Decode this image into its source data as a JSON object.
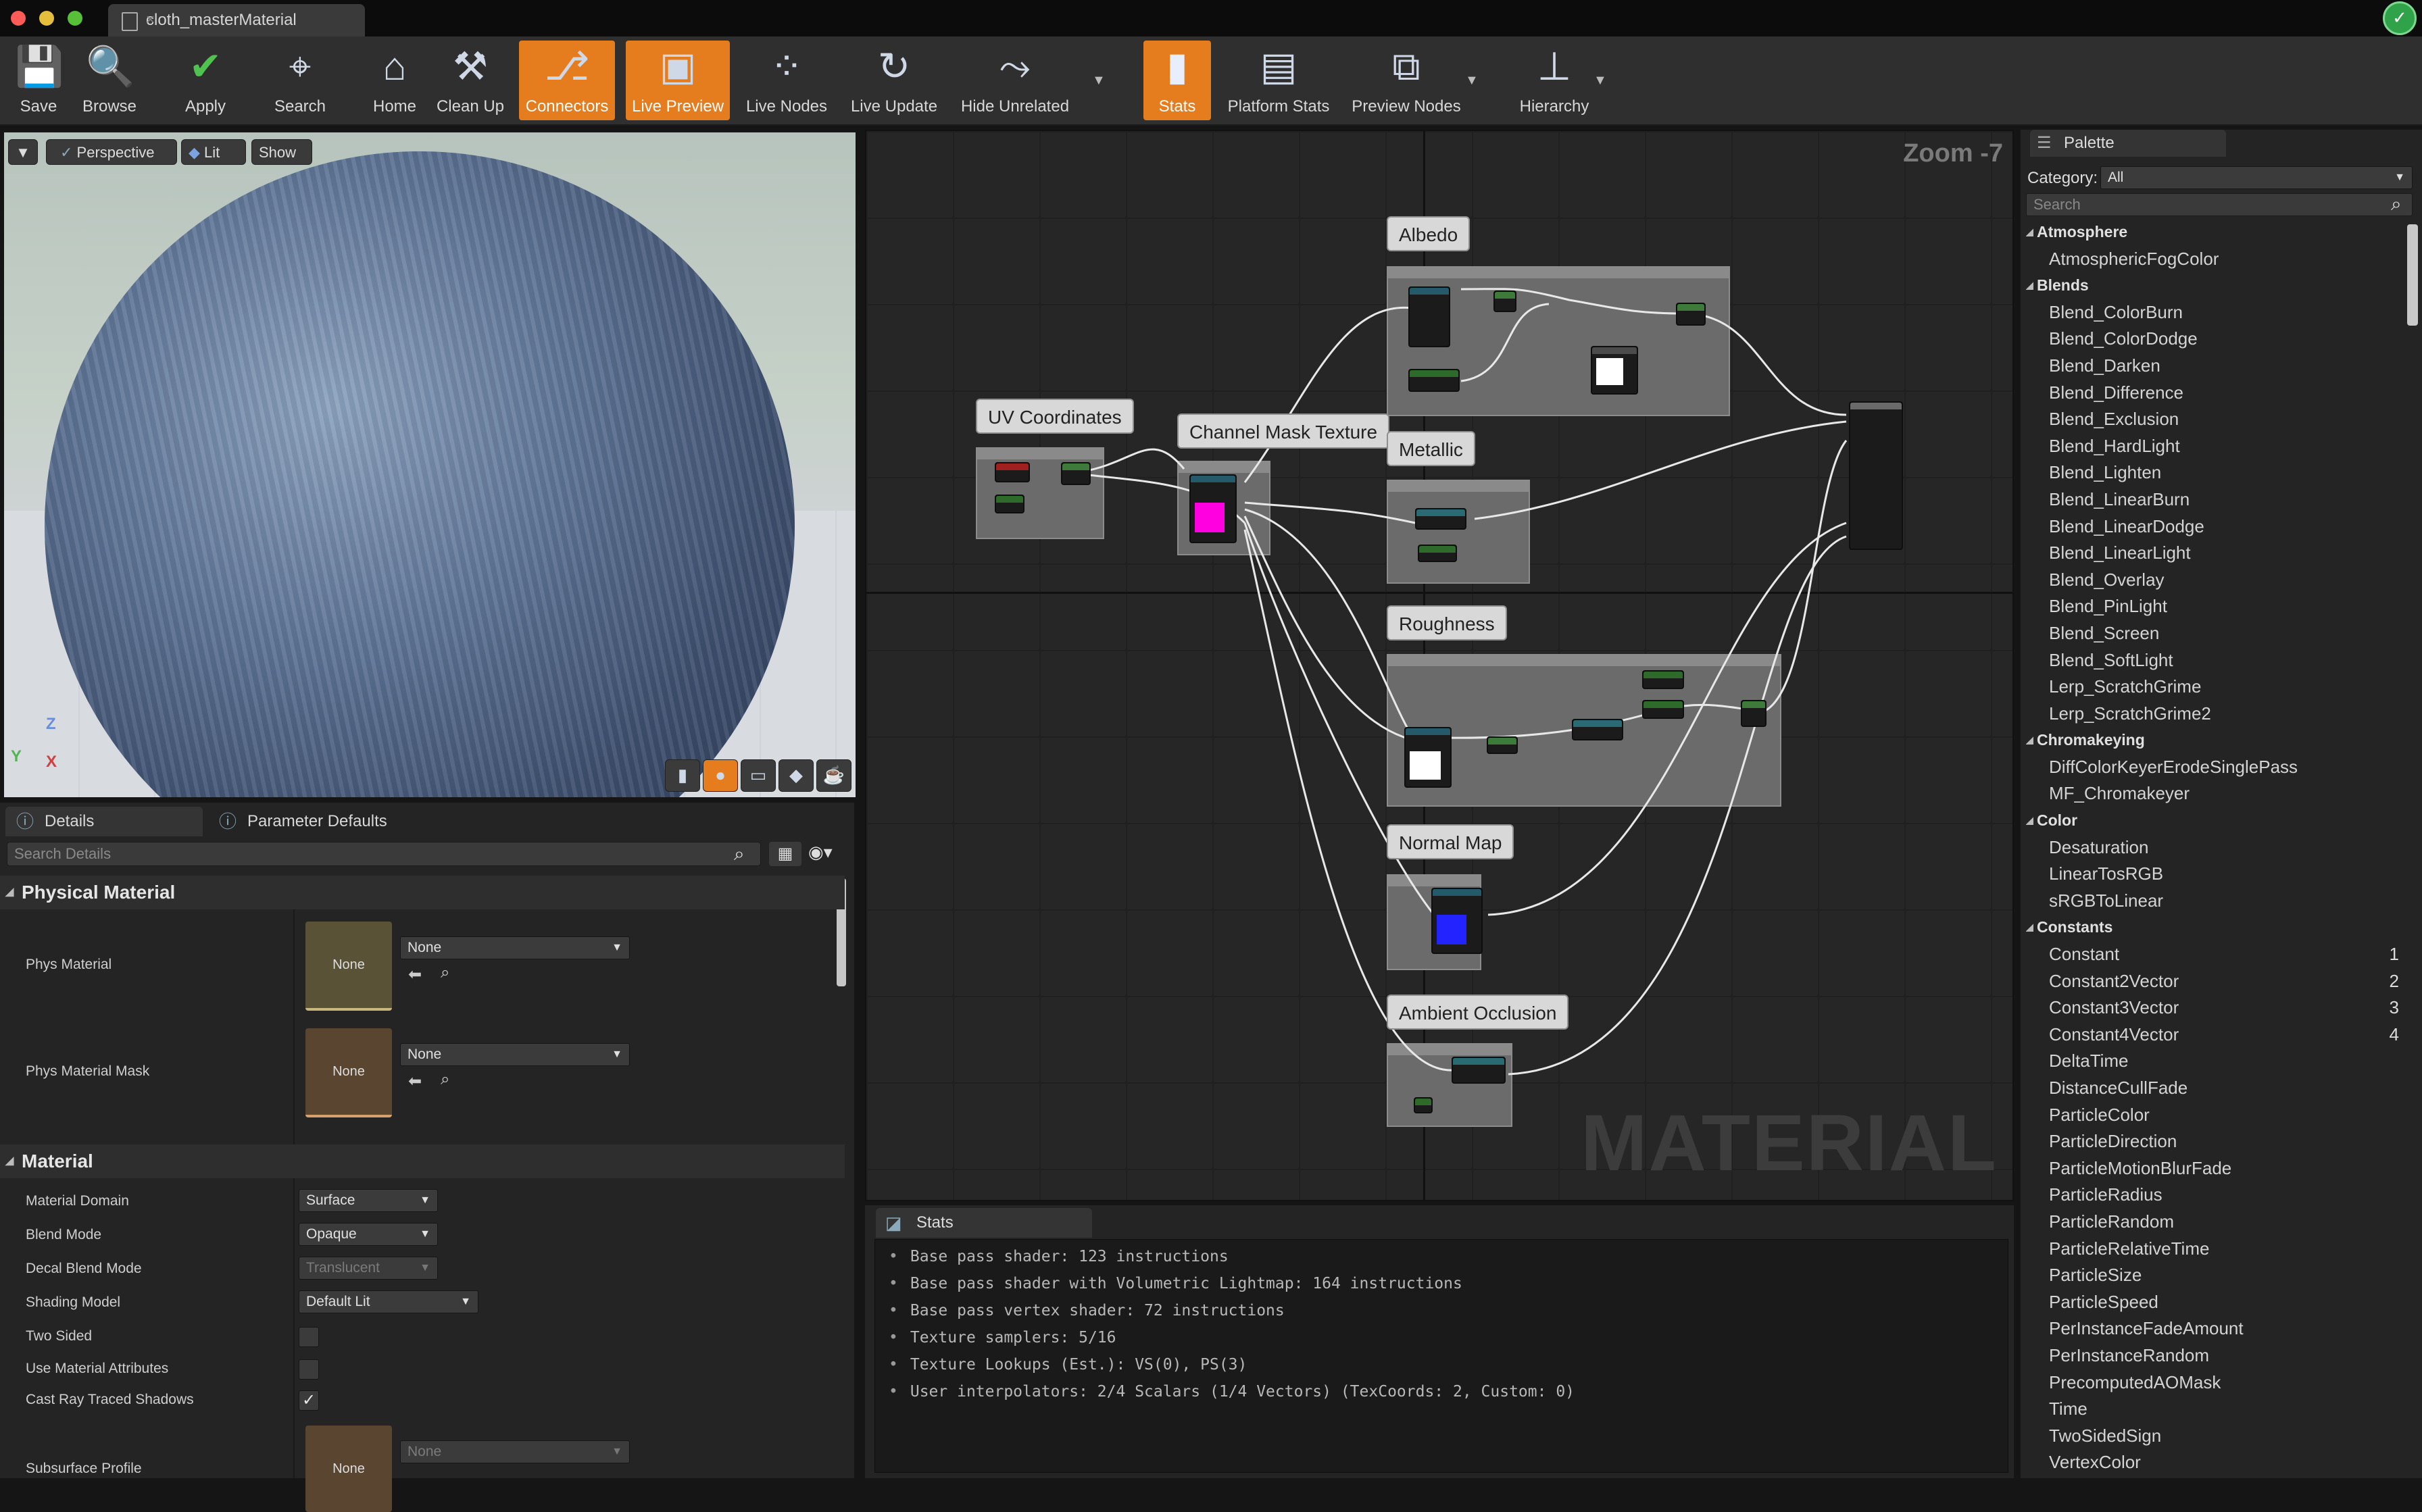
{
  "window": {
    "tab_title": "cloth_masterMaterial"
  },
  "toolbar": [
    {
      "label": "Save",
      "icon": "save-icon",
      "active": false
    },
    {
      "label": "Browse",
      "icon": "browse-icon",
      "active": false
    },
    {
      "label": "Apply",
      "icon": "apply-icon",
      "active": false
    },
    {
      "label": "Search",
      "icon": "search-icon",
      "active": false
    },
    {
      "label": "Home",
      "icon": "home-icon",
      "active": false
    },
    {
      "label": "Clean Up",
      "icon": "clean-up-icon",
      "active": false
    },
    {
      "label": "Connectors",
      "icon": "connectors-icon",
      "active": true
    },
    {
      "label": "Live Preview",
      "icon": "live-preview-icon",
      "active": true
    },
    {
      "label": "Live Nodes",
      "icon": "live-nodes-icon",
      "active": false
    },
    {
      "label": "Live Update",
      "icon": "live-update-icon",
      "active": false
    },
    {
      "label": "Hide Unrelated",
      "icon": "hide-unrelated-icon",
      "active": false
    },
    {
      "label": "Stats",
      "icon": "stats-icon",
      "active": true
    },
    {
      "label": "Platform Stats",
      "icon": "platform-stats-icon",
      "active": false
    },
    {
      "label": "Preview Nodes",
      "icon": "preview-nodes-icon",
      "active": false
    },
    {
      "label": "Hierarchy",
      "icon": "hierarchy-icon",
      "active": false
    }
  ],
  "viewport": {
    "view_mode": "Perspective",
    "lighting": "Lit",
    "show": "Show",
    "axes": {
      "z": "Z",
      "y": "Y",
      "x": "X"
    }
  },
  "details": {
    "tabs": [
      "Details",
      "Parameter Defaults"
    ],
    "search_placeholder": "Search Details",
    "physical_material": {
      "title": "Physical Material",
      "phys_material": {
        "label": "Phys Material",
        "thumb": "None",
        "value": "None"
      },
      "phys_material_mask": {
        "label": "Phys Material Mask",
        "thumb": "None",
        "value": "None"
      }
    },
    "material": {
      "title": "Material",
      "material_domain": {
        "label": "Material Domain",
        "value": "Surface"
      },
      "blend_mode": {
        "label": "Blend Mode",
        "value": "Opaque"
      },
      "decal_blend_mode": {
        "label": "Decal Blend Mode",
        "value": "Translucent"
      },
      "shading_model": {
        "label": "Shading Model",
        "value": "Default Lit"
      },
      "two_sided": {
        "label": "Two Sided",
        "checked": false
      },
      "use_material_attributes": {
        "label": "Use Material Attributes",
        "checked": false
      },
      "cast_ray_traced_shadows": {
        "label": "Cast Ray Traced Shadows",
        "checked": true
      },
      "subsurface_profile": {
        "label": "Subsurface Profile",
        "thumb": "None",
        "value": "None"
      }
    }
  },
  "graph": {
    "zoom": "Zoom -7",
    "watermark": "MATERIAL",
    "comments": [
      "Albedo",
      "UV Coordinates",
      "Channel Mask Texture",
      "Metallic",
      "Roughness",
      "Normal Map",
      "Ambient Occlusion"
    ]
  },
  "stats": {
    "tab": "Stats",
    "lines": [
      "Base pass shader: 123 instructions",
      "Base pass shader with Volumetric Lightmap: 164 instructions",
      "Base pass vertex shader: 72 instructions",
      "Texture samplers: 5/16",
      "Texture Lookups (Est.): VS(0), PS(3)",
      "User interpolators: 2/4 Scalars (1/4 Vectors) (TexCoords: 2, Custom: 0)"
    ]
  },
  "palette": {
    "tab": "Palette",
    "category_label": "Category:",
    "category_value": "All",
    "search_placeholder": "Search",
    "groups": [
      {
        "name": "Atmosphere",
        "items": [
          {
            "label": "AtmosphericFogColor"
          }
        ]
      },
      {
        "name": "Blends",
        "items": [
          {
            "label": "Blend_ColorBurn"
          },
          {
            "label": "Blend_ColorDodge"
          },
          {
            "label": "Blend_Darken"
          },
          {
            "label": "Blend_Difference"
          },
          {
            "label": "Blend_Exclusion"
          },
          {
            "label": "Blend_HardLight"
          },
          {
            "label": "Blend_Lighten"
          },
          {
            "label": "Blend_LinearBurn"
          },
          {
            "label": "Blend_LinearDodge"
          },
          {
            "label": "Blend_LinearLight"
          },
          {
            "label": "Blend_Overlay"
          },
          {
            "label": "Blend_PinLight"
          },
          {
            "label": "Blend_Screen"
          },
          {
            "label": "Blend_SoftLight"
          },
          {
            "label": "Lerp_ScratchGrime"
          },
          {
            "label": "Lerp_ScratchGrime2"
          }
        ]
      },
      {
        "name": "Chromakeying",
        "items": [
          {
            "label": "DiffColorKeyerErodeSinglePass"
          },
          {
            "label": "MF_Chromakeyer"
          }
        ]
      },
      {
        "name": "Color",
        "items": [
          {
            "label": "Desaturation"
          },
          {
            "label": "LinearTosRGB"
          },
          {
            "label": "sRGBToLinear"
          }
        ]
      },
      {
        "name": "Constants",
        "items": [
          {
            "label": "Constant",
            "hotkey": "1"
          },
          {
            "label": "Constant2Vector",
            "hotkey": "2"
          },
          {
            "label": "Constant3Vector",
            "hotkey": "3"
          },
          {
            "label": "Constant4Vector",
            "hotkey": "4"
          },
          {
            "label": "DeltaTime"
          },
          {
            "label": "DistanceCullFade"
          },
          {
            "label": "ParticleColor"
          },
          {
            "label": "ParticleDirection"
          },
          {
            "label": "ParticleMotionBlurFade"
          },
          {
            "label": "ParticleRadius"
          },
          {
            "label": "ParticleRandom"
          },
          {
            "label": "ParticleRelativeTime"
          },
          {
            "label": "ParticleSize"
          },
          {
            "label": "ParticleSpeed"
          },
          {
            "label": "PerInstanceFadeAmount"
          },
          {
            "label": "PerInstanceRandom"
          },
          {
            "label": "PrecomputedAOMask"
          },
          {
            "label": "Time"
          },
          {
            "label": "TwoSidedSign"
          },
          {
            "label": "VertexColor"
          }
        ]
      }
    ]
  },
  "colors": {
    "accent": "#e57c1e",
    "graph_bg": "#262626",
    "panel_bg": "#242424"
  }
}
